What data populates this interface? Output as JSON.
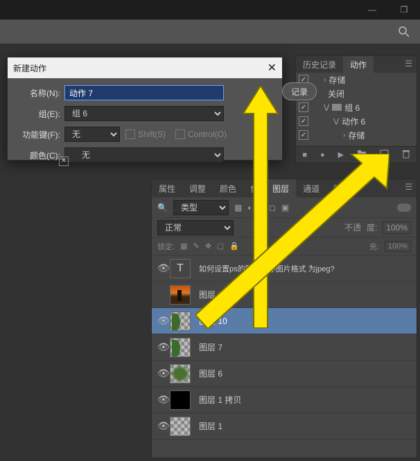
{
  "titlebar": {
    "min": "—",
    "restore": "❐"
  },
  "dialog": {
    "title": "新建动作",
    "name_label": "名称(N):",
    "name_value": "动作 7",
    "group_label": "组(E):",
    "group_value": "组 6",
    "fkey_label": "功能键(F):",
    "fkey_value": "无",
    "shift_label": "Shift(S)",
    "ctrl_label": "Control(O)",
    "color_label": "颜色(C):",
    "color_value": "无",
    "record_btn": "记录"
  },
  "actions_panel": {
    "tab_history": "历史记录",
    "tab_actions": "动作",
    "items": [
      "存储",
      "关闭",
      "组 6",
      "动作 6",
      "存储"
    ]
  },
  "layers_panel": {
    "tabs": [
      "属性",
      "调整",
      "颜色",
      "色",
      "图层",
      "通道",
      "路"
    ],
    "kind": "类型",
    "blend": "正常",
    "opacity_label": "不透",
    "opacity_suffix": "度:",
    "opacity_value": "100%",
    "lock_label": "锁定:",
    "fill_label": "充:",
    "fill_value": "100%",
    "layers": [
      {
        "name": "如何设置ps的默认保存图片格式 为jpeg?",
        "type": "text"
      },
      {
        "name": "图层 2",
        "type": "img1"
      },
      {
        "name": "图层 10",
        "type": "leaf",
        "active": true
      },
      {
        "name": "图层 7",
        "type": "leaf"
      },
      {
        "name": "图层 6",
        "type": "blur"
      },
      {
        "name": "图层 1 拷贝",
        "type": "black"
      },
      {
        "name": "图层 1",
        "type": "chk"
      }
    ]
  }
}
